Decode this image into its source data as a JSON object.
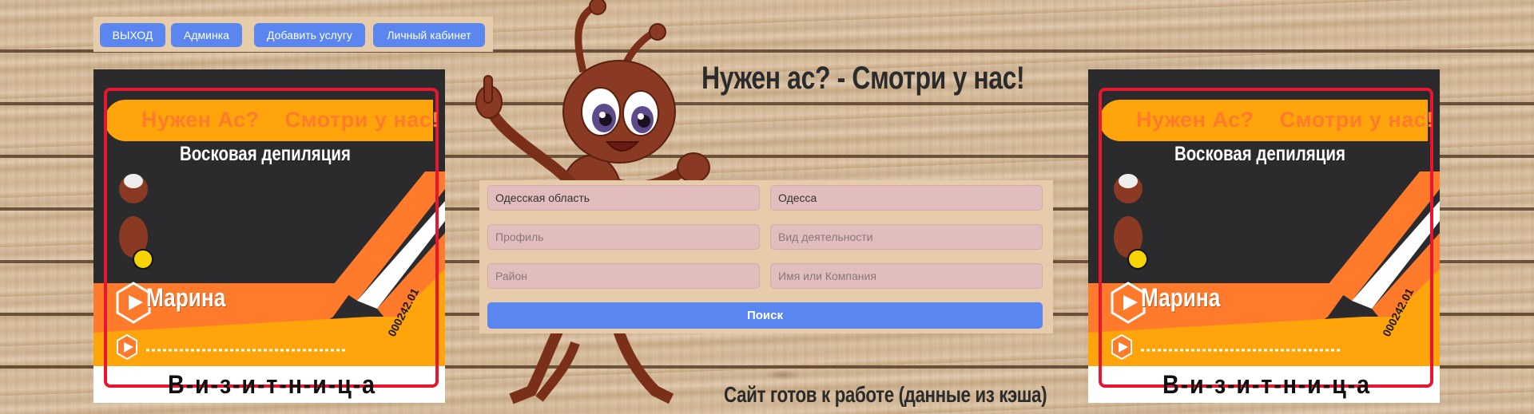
{
  "nav": {
    "exit_label": "ВЫХОД",
    "admin_label": "Админка",
    "add_service_label": "Добавить услугу",
    "cabinet_label": "Личный кабинет"
  },
  "headline": "Нужен ас? - Смотри у нас!",
  "status": "Сайт готов к работе (данные из кэша)",
  "cards": [
    {
      "header_left": "Нужен Ас?",
      "header_right": "Смотри у нас!",
      "service": "Восковая депиляция",
      "name": "Марина",
      "number": "000242.01",
      "bottom": "В-и-з-и-т-н-и-ц-а",
      "colors": {
        "dark": "#2b2b2d",
        "orange": "#ff7a2a",
        "yellow": "#ffa40a",
        "frame": "#e8162f"
      }
    },
    {
      "header_left": "Нужен Ас?",
      "header_right": "Смотри у нас!",
      "service": "Восковая депиляция",
      "name": "Марина",
      "number": "000242.01",
      "bottom": "В-и-з-и-т-н-и-ц-а",
      "colors": {
        "dark": "#2b2b2d",
        "orange": "#ff7a2a",
        "yellow": "#ffa40a",
        "frame": "#e8162f"
      }
    }
  ],
  "form": {
    "region_value": "Одесская область",
    "city_value": "Одесса",
    "profile_placeholder": "Профиль",
    "activity_placeholder": "Вид деятельности",
    "district_placeholder": "Район",
    "name_placeholder": "Имя или Компания",
    "search_label": "Поиск"
  },
  "colors": {
    "button": "#5b86ef",
    "panel": "#e6ccaa",
    "field": "#e2bdbd"
  }
}
